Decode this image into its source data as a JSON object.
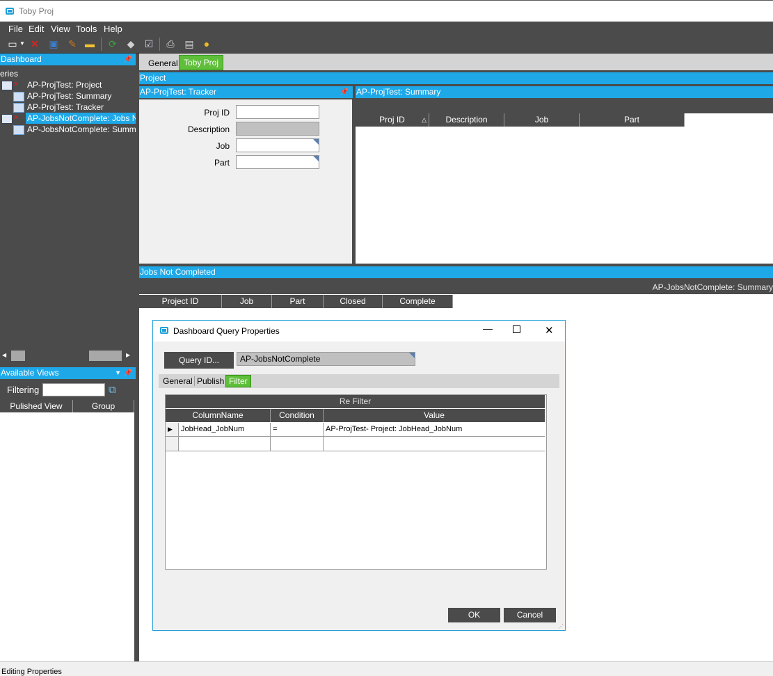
{
  "window": {
    "title": "Toby Proj"
  },
  "menu": [
    "File",
    "Edit",
    "View",
    "Tools",
    "Help"
  ],
  "left": {
    "dashboard_header": "Dashboard",
    "queries_label": "eries",
    "tree": [
      "AP-ProjTest: Project",
      "AP-ProjTest: Summary",
      "AP-ProjTest: Tracker",
      "AP-JobsNotComplete: Jobs N",
      "AP-JobsNotComplete: Summ"
    ],
    "available_views_header": "Available Views",
    "filtering_label": "Filtering",
    "filter_value": "",
    "grid_headers": [
      "Pulished View",
      "Group"
    ]
  },
  "tabs": [
    "General",
    "Toby Proj"
  ],
  "project_bar": "Project",
  "tracker": {
    "header": "AP-ProjTest: Tracker",
    "fields": [
      {
        "label": "Proj ID",
        "value": ""
      },
      {
        "label": "Description",
        "value": ""
      },
      {
        "label": "Job",
        "value": ""
      },
      {
        "label": "Part",
        "value": ""
      }
    ]
  },
  "summary": {
    "header": "AP-ProjTest: Summary",
    "columns": [
      "Proj ID",
      "Description",
      "Job",
      "Part"
    ]
  },
  "jobs": {
    "header": "Jobs Not Completed",
    "grid_title": "AP-JobsNotComplete: Summary",
    "columns": [
      "Project ID",
      "Job",
      "Part",
      "Closed",
      "Complete"
    ]
  },
  "dialog": {
    "title": "Dashboard Query Properties",
    "query_button": "Query ID...",
    "query_value": "AP-JobsNotComplete",
    "tabs": [
      "General",
      "Publish",
      "Filter"
    ],
    "filter_grid_title": "Re Filter",
    "columns": [
      "ColumnName",
      "Condition",
      "Value"
    ],
    "rows": [
      {
        "column": "JobHead_JobNum",
        "condition": "=",
        "value": "AP-ProjTest- Project: JobHead_JobNum"
      }
    ],
    "ok": "OK",
    "cancel": "Cancel"
  },
  "status": {
    "text": "Editing Properties"
  },
  "colors": {
    "accent": "#1ea8e8",
    "dark": "#4b4b4b",
    "active_tab": "#5fbf3a"
  }
}
